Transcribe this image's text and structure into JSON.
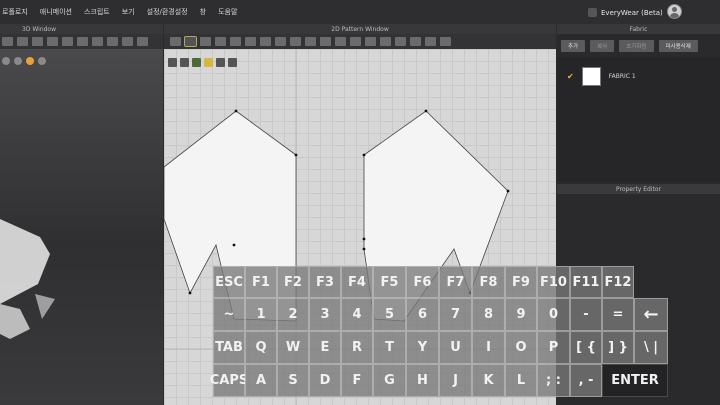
{
  "menu": {
    "items": [
      "로폴로지",
      "애니메이션",
      "스크립트",
      "보기",
      "설정/환경설정",
      "창",
      "도움말"
    ]
  },
  "mode": {
    "label": "EveryWear (Beta)"
  },
  "windows": {
    "view3d_title": "3D Window",
    "pattern_title": "2D Pattern Window",
    "fabric_title": "Fabric"
  },
  "fabric": {
    "buttons": [
      "추가",
      "복사",
      "초기화됨",
      "미사용삭제"
    ],
    "item_name": "FABRIC 1"
  },
  "property_editor": {
    "title": "Property Editor"
  },
  "keyboard": {
    "fn_row": [
      "ESC",
      "F1",
      "F2",
      "F3",
      "F4",
      "F5",
      "F6",
      "F7",
      "F8",
      "F9",
      "F10",
      "F11",
      "F12"
    ],
    "num_row": [
      "~",
      "1",
      "2",
      "3",
      "4",
      "5",
      "6",
      "7",
      "8",
      "9",
      "0",
      "-",
      "=",
      "←"
    ],
    "q_row": [
      "TAB",
      "Q",
      "W",
      "E",
      "R",
      "T",
      "Y",
      "U",
      "I",
      "O",
      "P",
      "[ {",
      "] }",
      "\\ |"
    ],
    "a_row": [
      "CAPS",
      "A",
      "S",
      "D",
      "F",
      "G",
      "H",
      "J",
      "K",
      "L",
      "; :",
      ", -",
      "ENTER"
    ]
  },
  "colors": {
    "accent_yellow": "#e8b93a",
    "canvas_bg": "#d7d7d7",
    "panel_bg": "#2a2a2c"
  }
}
